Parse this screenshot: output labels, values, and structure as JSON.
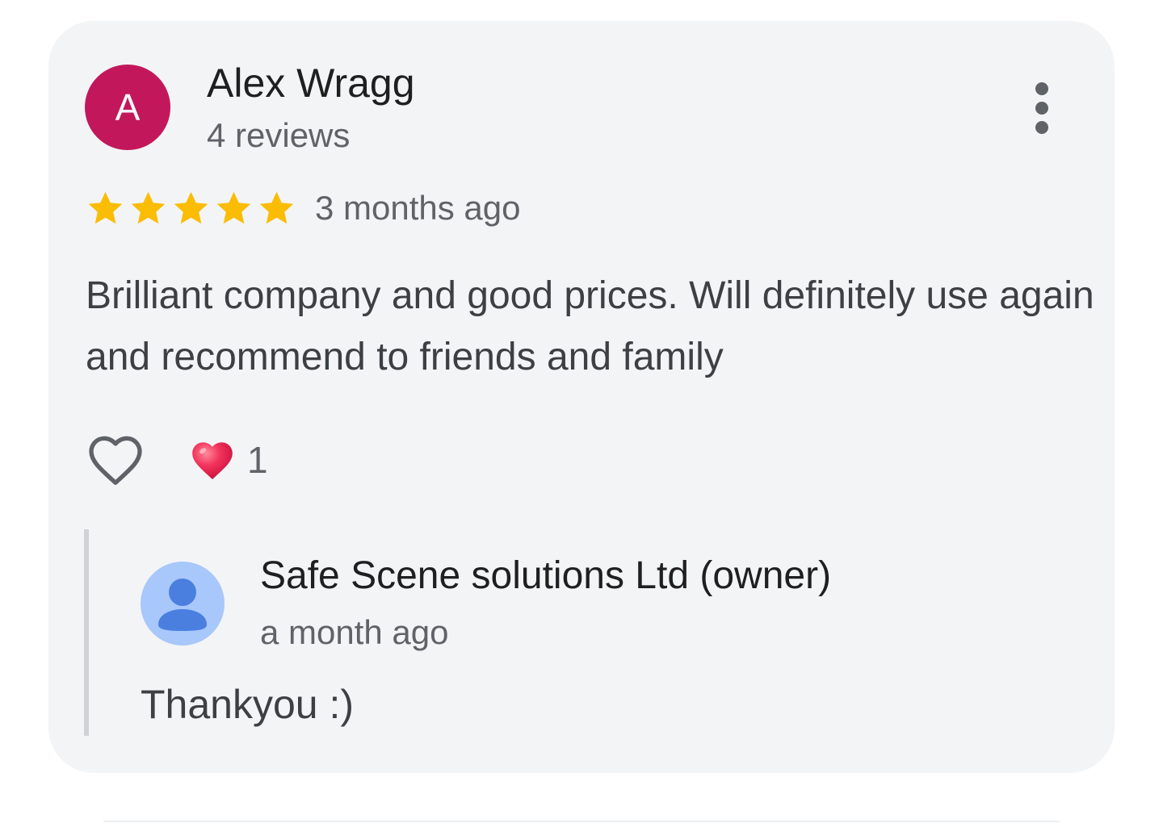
{
  "review": {
    "avatar_letter": "A",
    "avatar_color": "#c2185b",
    "author_name": "Alex Wragg",
    "author_review_count": "4 reviews",
    "more_options_icon": "more-vert-icon",
    "rating": 5,
    "rating_max": 5,
    "star_color": "#fbbc04",
    "time_ago": "3 months ago",
    "text": "Brilliant company and good prices. Will definitely use again and recommend to friends and family",
    "like_icon": "heart-outline-icon",
    "reaction_icon": "red-heart-emoji-icon",
    "reaction_count": "1"
  },
  "owner_response": {
    "avatar_icon": "default-person-icon",
    "name": "Safe Scene solutions Ltd (owner)",
    "time_ago": "a month ago",
    "text": "Thankyou :)"
  }
}
